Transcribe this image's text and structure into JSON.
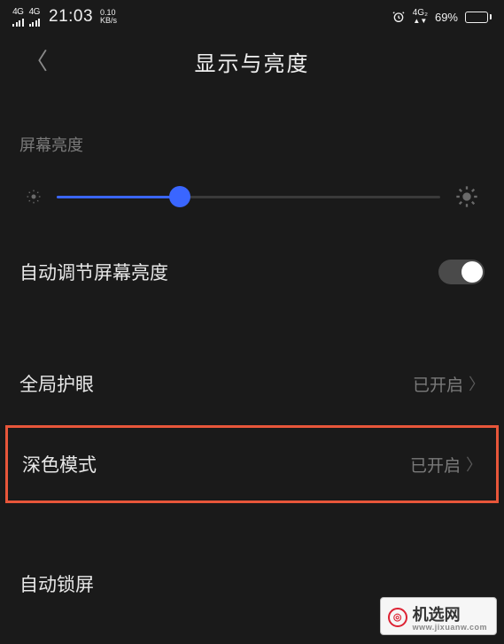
{
  "status_bar": {
    "signal1_label": "4G",
    "signal2_label": "4G",
    "time": "21:03",
    "speed_value": "0.10",
    "speed_unit": "KB/s",
    "net_indicator": "4G₂",
    "battery_pct": "69%"
  },
  "header": {
    "title": "显示与亮度"
  },
  "brightness": {
    "section_label": "屏幕亮度",
    "slider_value_pct": 32
  },
  "rows": {
    "auto_brightness": {
      "label": "自动调节屏幕亮度",
      "toggle_on": true
    },
    "eye_protect": {
      "label": "全局护眼",
      "value": "已开启"
    },
    "dark_mode": {
      "label": "深色模式",
      "value": "已开启"
    },
    "auto_lock": {
      "label": "自动锁屏"
    }
  },
  "watermark": {
    "brand": "机选网",
    "url": "www.jixuanw.com"
  }
}
